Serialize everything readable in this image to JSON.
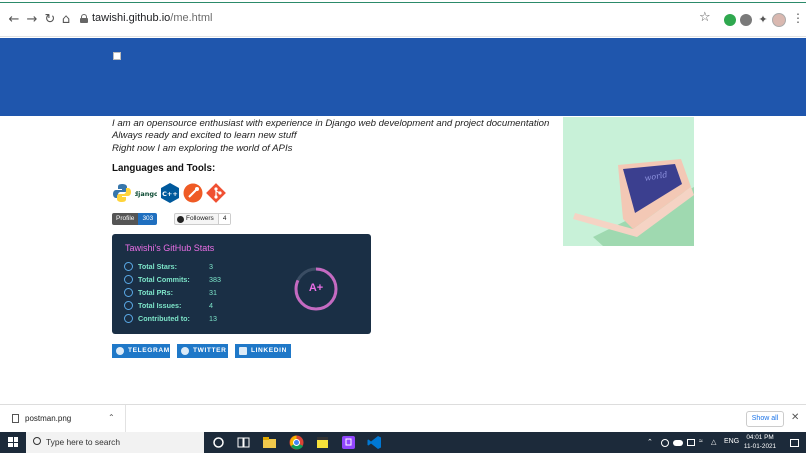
{
  "browser": {
    "url_domain": "tawishi.github.io",
    "url_path": "/me.html"
  },
  "page": {
    "intro_lines": [
      "I am an opensource enthusiast with experience in Django web development and project documentation",
      "Always ready and excited to learn new stuff",
      "Right now I am exploring the world of APIs"
    ],
    "languages_heading": "Languages and Tools:",
    "tools_icons": [
      "python-icon",
      "django-icon",
      "cplusplus-icon",
      "postman-icon",
      "git-icon"
    ],
    "django_label": "django",
    "cpp_label": "C++",
    "badges": {
      "profile_views_label": "Profile views",
      "profile_views_count": "303",
      "followers_label": "Followers",
      "followers_count": "4"
    },
    "stats": {
      "title": "Tawishi's GitHub Stats",
      "rows": [
        {
          "label": "Total Stars:",
          "value": "3",
          "icon": "star-icon"
        },
        {
          "label": "Total Commits:",
          "value": "383",
          "icon": "clock-icon"
        },
        {
          "label": "Total PRs:",
          "value": "31",
          "icon": "pull-request-icon"
        },
        {
          "label": "Total Issues:",
          "value": "4",
          "icon": "issue-icon"
        },
        {
          "label": "Contributed to:",
          "value": "13",
          "icon": "repo-icon"
        }
      ],
      "grade": "A+",
      "grade_fraction": 0.82,
      "colors": {
        "background": "#1a2f45",
        "title": "#ea6ee5",
        "text": "#7de5c9",
        "icon": "#5aa9e6"
      }
    },
    "social_buttons": [
      {
        "label": "TELEGRAM",
        "icon": "telegram-icon"
      },
      {
        "label": "TWITTER",
        "icon": "twitter-icon"
      },
      {
        "label": "LINKEDIN",
        "icon": "linkedin-icon"
      }
    ],
    "illustration_text": "world",
    "colors": {
      "banner": "#1f56ad",
      "accent": "#1f78c8"
    }
  },
  "downloads": {
    "file_name": "postman.png",
    "show_all_label": "Show all"
  },
  "taskbar": {
    "search_placeholder": "Type here to search",
    "language": "ENG",
    "time": "04:01 PM",
    "date": "11-01-2021"
  }
}
